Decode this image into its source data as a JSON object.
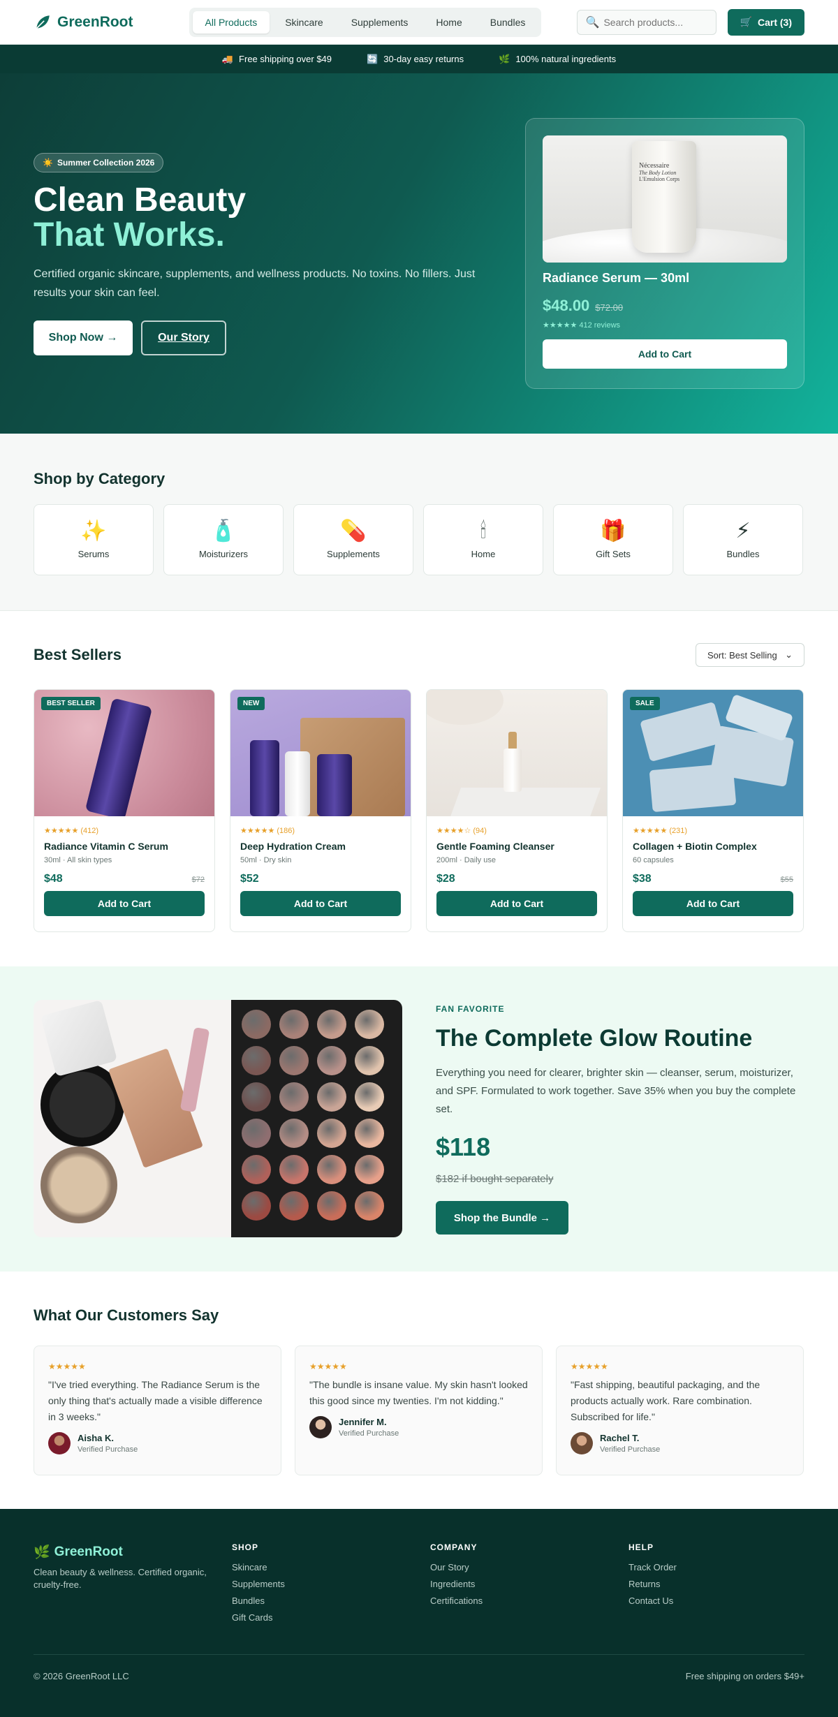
{
  "brand": {
    "name": "GreenRoot"
  },
  "nav": {
    "tabs": [
      "All Products",
      "Skincare",
      "Supplements",
      "Home",
      "Bundles"
    ]
  },
  "search": {
    "placeholder": "Search products..."
  },
  "cart": {
    "label": "Cart (3)"
  },
  "announce": [
    "Free shipping over $49",
    "30-day easy returns",
    "100% natural ingredients"
  ],
  "hero": {
    "badge": "Summer Collection 2026",
    "title_line1": "Clean Beauty",
    "title_line2": "That Works.",
    "description": "Certified organic skincare, supplements, and wellness products. No toxins. No fillers. Just results your skin can feel.",
    "shop_now": "Shop Now →",
    "our_story": "Our Story",
    "featured": {
      "image_text_1": "Nécessaire",
      "image_text_2": "The Body Lotion",
      "image_text_3": "L'Emulsion Corps",
      "name": "Radiance Serum — 30ml",
      "price": "$48.00",
      "old_price": "$72.00",
      "reviews": "★★★★★ 412 reviews",
      "add_to_cart": "Add to Cart"
    }
  },
  "categories": {
    "title": "Shop by Category",
    "items": [
      {
        "label": "Serums",
        "icon": "✨"
      },
      {
        "label": "Moisturizers",
        "icon": "🧴"
      },
      {
        "label": "Supplements",
        "icon": "💊"
      },
      {
        "label": "Home",
        "icon": "🕯"
      },
      {
        "label": "Gift Sets",
        "icon": "🎁"
      },
      {
        "label": "Bundles",
        "icon": "⚡"
      }
    ]
  },
  "best_sellers": {
    "title": "Best Sellers",
    "sort": "Sort: Best Selling",
    "products": [
      {
        "tag": "BEST SELLER",
        "stars": "★★★★★",
        "count": "(412)",
        "name": "Radiance Vitamin C Serum",
        "sub": "30ml · All skin types",
        "price": "$48",
        "old": "$72",
        "btn": "Add to Cart"
      },
      {
        "tag": "NEW",
        "stars": "★★★★★",
        "count": "(186)",
        "name": "Deep Hydration Cream",
        "sub": "50ml · Dry skin",
        "price": "$52",
        "old": "",
        "btn": "Add to Cart"
      },
      {
        "tag": "",
        "stars": "★★★★☆",
        "count": "(94)",
        "name": "Gentle Foaming Cleanser",
        "sub": "200ml · Daily use",
        "price": "$28",
        "old": "",
        "btn": "Add to Cart"
      },
      {
        "tag": "SALE",
        "stars": "★★★★★",
        "count": "(231)",
        "name": "Collagen + Biotin Complex",
        "sub": "60 capsules",
        "price": "$38",
        "old": "$55",
        "btn": "Add to Cart"
      }
    ]
  },
  "promo": {
    "eyebrow": "FAN FAVORITE",
    "title": "The Complete Glow Routine",
    "description": "Everything you need for clearer, brighter skin — cleanser, serum, moisturizer, and SPF. Formulated to work together. Save 35% when you buy the complete set.",
    "price": "$118",
    "strike": "$182 if bought separately",
    "button": "Shop the Bundle →"
  },
  "reviews": {
    "title": "What Our Customers Say",
    "items": [
      {
        "stars": "★★★★★",
        "text": "\"I've tried everything. The Radiance Serum is the only thing that's actually made a visible difference in 3 weeks.\"",
        "name": "Aisha K.",
        "verified": "Verified Purchase"
      },
      {
        "stars": "★★★★★",
        "text": "\"The bundle is insane value. My skin hasn't looked this good since my twenties. I'm not kidding.\"",
        "name": "Jennifer M.",
        "verified": "Verified Purchase"
      },
      {
        "stars": "★★★★★",
        "text": "\"Fast shipping, beautiful packaging, and the products actually work. Rare combination. Subscribed for life.\"",
        "name": "Rachel T.",
        "verified": "Verified Purchase"
      }
    ]
  },
  "footer": {
    "tagline": "Clean beauty & wellness. Certified organic, cruelty-free.",
    "shop": {
      "title": "SHOP",
      "links": [
        "Skincare",
        "Supplements",
        "Bundles",
        "Gift Cards"
      ]
    },
    "company": {
      "title": "COMPANY",
      "links": [
        "Our Story",
        "Ingredients",
        "Certifications"
      ]
    },
    "help": {
      "title": "HELP",
      "links": [
        "Track Order",
        "Returns",
        "Contact Us"
      ]
    },
    "copyright": "© 2026 GreenRoot LLC",
    "shipping": "Free shipping on orders $49+"
  },
  "colors": {
    "primary": "#0f6b5c",
    "accent": "#8ff0d7",
    "dark": "#08302b",
    "star": "#e7a02a"
  }
}
